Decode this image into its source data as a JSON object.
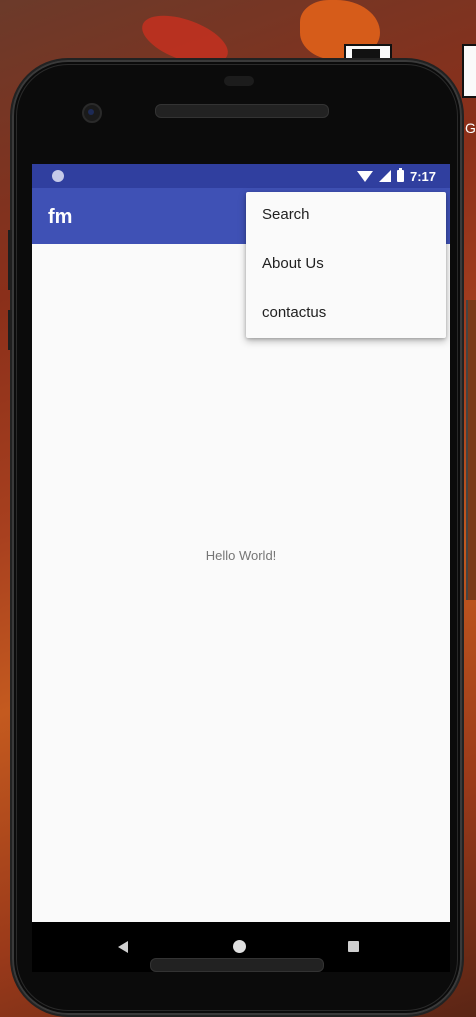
{
  "status_bar": {
    "time": "7:17"
  },
  "app_bar": {
    "title": "fm"
  },
  "menu": {
    "items": [
      {
        "label": "Search"
      },
      {
        "label": "About Us"
      },
      {
        "label": "contactus"
      }
    ]
  },
  "content": {
    "text": "Hello World!"
  },
  "background": {
    "partial_text": "G"
  },
  "colors": {
    "status_bar": "#303f9f",
    "app_bar": "#3f51b5",
    "screen_bg": "#fafafa"
  }
}
